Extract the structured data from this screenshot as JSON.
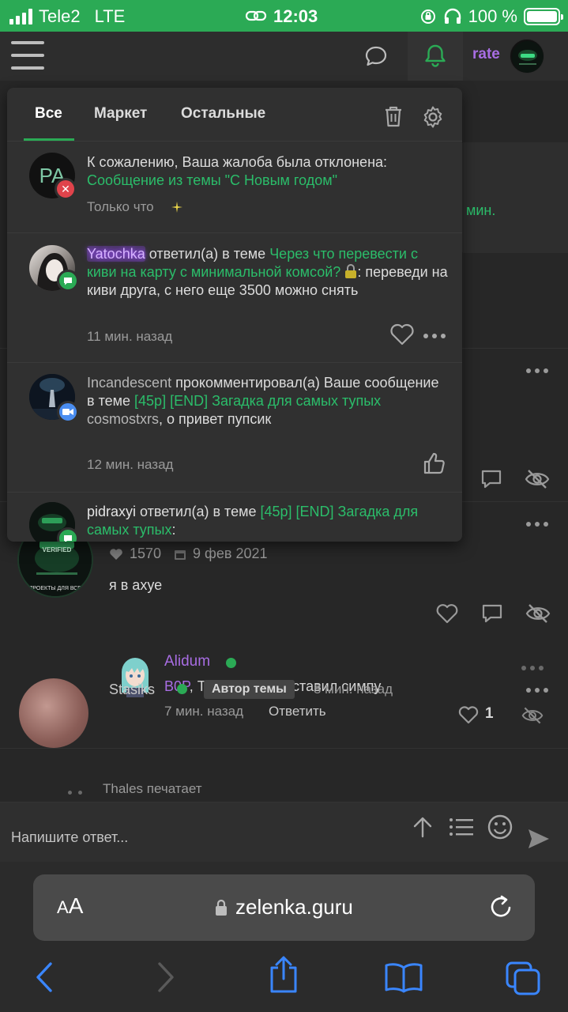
{
  "status_bar": {
    "carrier": "Tele2",
    "network": "LTE",
    "time": "12:03",
    "battery": "100 %"
  },
  "header": {
    "rate_label": "rate"
  },
  "notifications": {
    "tabs": [
      "Все",
      "Маркет",
      "Остальные"
    ],
    "active_tab": "Все",
    "items": [
      {
        "avatar_initials": "PA",
        "text": "К сожалению, Ваша жалоба была отклонена:",
        "link": "Сообщение из темы \"С Новым годом\"",
        "time": "Только что"
      },
      {
        "user": "Yatochka",
        "action": "ответил(а) в теме",
        "link": "Через что перевести с киви на карту с минимальной комсой?",
        "quote": "переведи на киви друга, с него еще 3500 можно снять",
        "time": "11 мин. назад"
      },
      {
        "user": "Incandescent",
        "action": "прокомментировал(а) Ваше сообщение в теме",
        "link": "[45p] [END] Загадка для самых тупых",
        "quote_user": "cosmostxrs",
        "quote": ", о привет пупсик",
        "time": "12 мин. назад"
      },
      {
        "user": "pidraxyi",
        "action": "ответил(а) в теме",
        "link": "[45p] [END] Загадка для самых тупых",
        "suffix": ":"
      }
    ]
  },
  "background": {
    "time_fragment": "мин.",
    "post": {
      "likes": "1570",
      "date": "9 фев 2021",
      "text": "я в ахуе",
      "avatar_label": "VERIFIED",
      "avatar_caption": "ПРОЕКТЫ ДЛЯ ВСЕХ"
    },
    "reply": {
      "user": "Alidum",
      "mention": "B0P",
      "text": ", Ты в ахуе и поставил симпу",
      "time": "7 мин. назад",
      "answer_label": "Ответить",
      "likes": "1"
    },
    "next_post": {
      "user": "Stasiks",
      "badge": "Автор темы",
      "time": "8 мин. назад"
    }
  },
  "typing": {
    "text": "Thales печатает"
  },
  "composer": {
    "placeholder": "Напишите ответ..."
  },
  "browser": {
    "text_size_small": "A",
    "text_size_large": "A",
    "url": "zelenka.guru"
  },
  "colors": {
    "accent_green": "#2baa55",
    "link_green": "#2bbd6a",
    "username_purple": "#a86de3",
    "background": "#272727"
  }
}
